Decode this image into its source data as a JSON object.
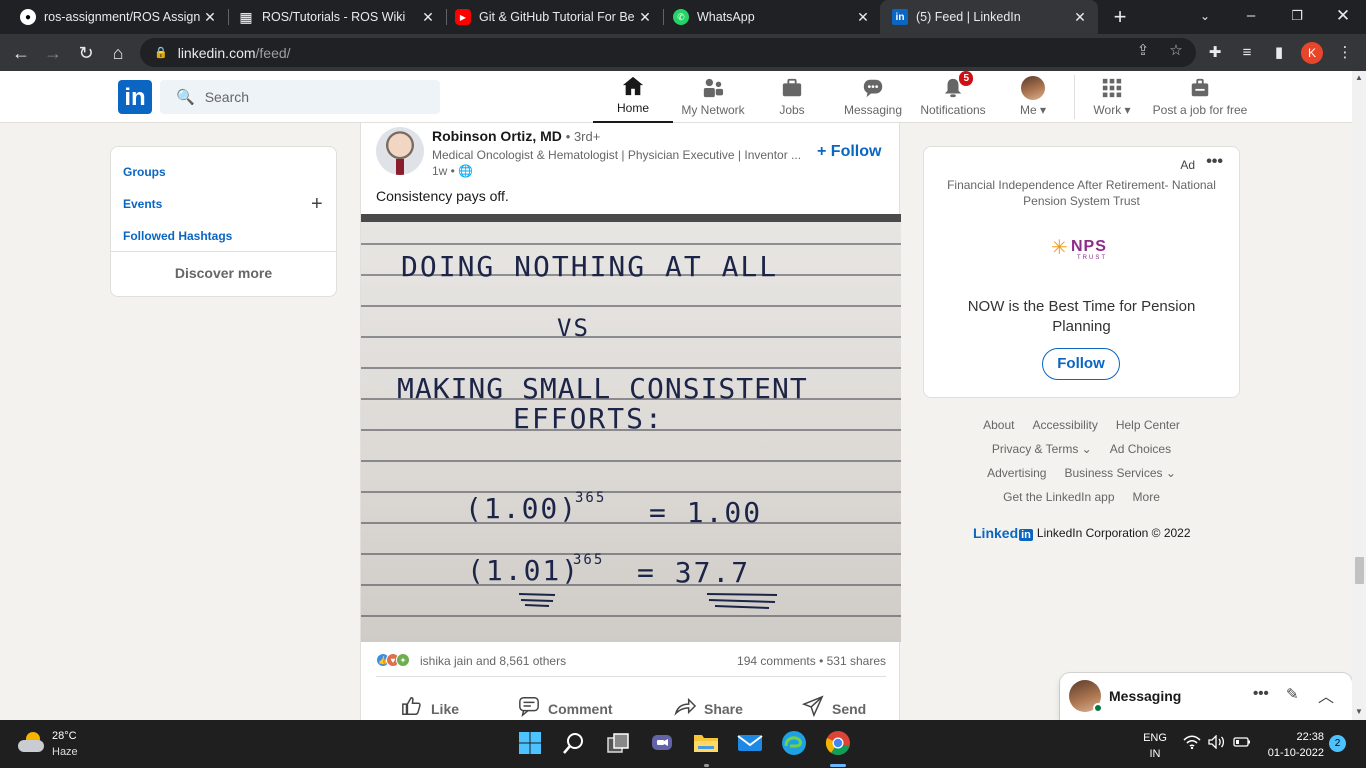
{
  "browser": {
    "tabs": [
      {
        "title": "ros-assignment/ROS Assignm",
        "favicon": "github-icon"
      },
      {
        "title": "ROS/Tutorials - ROS Wiki",
        "favicon": "ros-grid-icon"
      },
      {
        "title": "Git & GitHub Tutorial For Beg",
        "favicon": "youtube-icon"
      },
      {
        "title": "WhatsApp",
        "favicon": "whatsapp-icon"
      },
      {
        "title": "(5) Feed | LinkedIn",
        "favicon": "linkedin-icon",
        "active": true
      }
    ],
    "url_domain": "linkedin.com",
    "url_path": "/feed/",
    "profile_initial": "K"
  },
  "linkedin": {
    "search_placeholder": "Search",
    "nav": [
      {
        "label": "Home",
        "icon": "home-icon",
        "active": true
      },
      {
        "label": "My Network",
        "icon": "network-icon"
      },
      {
        "label": "Jobs",
        "icon": "briefcase-icon"
      },
      {
        "label": "Messaging",
        "icon": "chat-icon"
      },
      {
        "label": "Notifications",
        "icon": "bell-icon",
        "badge": "5"
      },
      {
        "label": "Me",
        "icon": "avatar"
      },
      {
        "label": "Work",
        "icon": "grid-icon"
      },
      {
        "label": "Post a job for free",
        "icon": "post-job-icon"
      }
    ],
    "left_rail": {
      "links": [
        "Groups",
        "Events",
        "Followed Hashtags"
      ],
      "discover": "Discover more"
    },
    "post": {
      "author": "Robinson Ortiz, MD",
      "degree": "• 3rd+",
      "headline": "Medical Oncologist & Hematologist | Physician Executive | Inventor ...",
      "time": "1w •",
      "follow": "+ Follow",
      "text": "Consistency pays off.",
      "image_lines": [
        "DOING NOTHING AT ALL",
        "VS",
        "MAKING SMALL CONSISTENT",
        "EFFORTS:",
        "(1.00)",
        "365",
        "= 1.00",
        "(1.01)",
        "365",
        "= 37.7"
      ],
      "reactions_who": "ishika jain and 8,561 others",
      "stats": "194 comments • 531 shares",
      "actions": [
        "Like",
        "Comment",
        "Share",
        "Send"
      ]
    },
    "ad": {
      "label": "Ad",
      "sponsor": "Financial Independence After Retirement- National Pension System Trust",
      "logo_text": "NPS",
      "logo_sub": "TRUST",
      "headline": "NOW is the Best Time for Pension Planning",
      "follow": "Follow"
    },
    "footer": {
      "row1": [
        "About",
        "Accessibility",
        "Help Center"
      ],
      "row2": [
        "Privacy & Terms ⌄",
        "Ad Choices"
      ],
      "row3": [
        "Advertising",
        "Business Services ⌄"
      ],
      "row4": [
        "Get the LinkedIn app",
        "More"
      ],
      "brand_word": "Linked",
      "brand_in": "in",
      "copyright": "LinkedIn Corporation © 2022"
    },
    "messaging": {
      "title": "Messaging"
    }
  },
  "taskbar": {
    "temp": "28°C",
    "weather": "Haze",
    "lang1": "ENG",
    "lang2": "IN",
    "time": "22:38",
    "date": "01-10-2022",
    "notifications": "2"
  }
}
